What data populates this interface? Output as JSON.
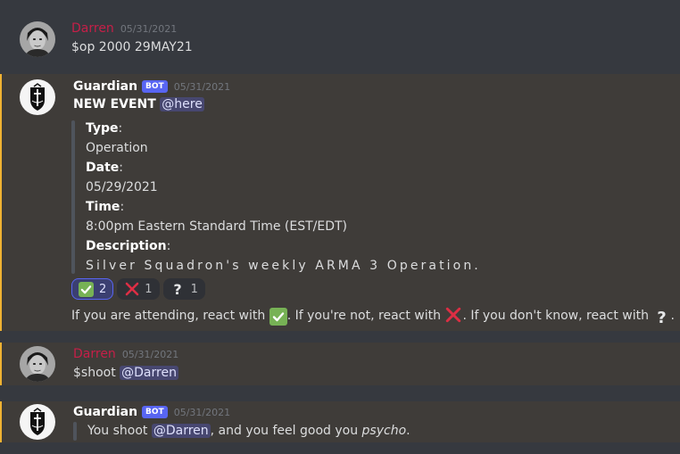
{
  "messages": [
    {
      "author": "Darren",
      "timestamp": "05/31/2021",
      "text": "$op 2000 29MAY21"
    },
    {
      "author": "Guardian",
      "bot_tag": "BOT",
      "timestamp": "05/31/2021",
      "title": "NEW EVENT",
      "mention": "@here",
      "embed": {
        "type_label": "Type",
        "type_value": "Operation",
        "date_label": "Date",
        "date_value": "05/29/2021",
        "time_label": "Time",
        "time_value": "8:00pm Eastern Standard Time (EST/EDT)",
        "desc_label": "Description",
        "desc_value": "Silver Squadron's weekly ARMA 3 Operation."
      },
      "reactions": [
        {
          "emoji": "check-mark-icon",
          "count": "2"
        },
        {
          "emoji": "cross-mark-icon",
          "count": "1"
        },
        {
          "emoji": "question-mark-icon",
          "count": "1"
        }
      ],
      "footer_part1": "If you are attending, react with ",
      "footer_part2": ". If you're not, react with ",
      "footer_part3": ". If you don't know, react with ",
      "footer_part4": "."
    },
    {
      "author": "Darren",
      "timestamp": "05/31/2021",
      "command": "$shoot",
      "mention": "@Darren"
    },
    {
      "author": "Guardian",
      "bot_tag": "BOT",
      "timestamp": "05/31/2021",
      "text_pre": "You shoot ",
      "mention": "@Darren",
      "text_mid": ", and you feel good you ",
      "text_italic": "psycho",
      "text_end": "."
    }
  ],
  "colors": {
    "background": "#36393f",
    "highlight_bg": "#3f3c39",
    "highlight_border": "#f0b232",
    "darren_name": "#c61f48",
    "bot_badge": "#5865f2"
  }
}
